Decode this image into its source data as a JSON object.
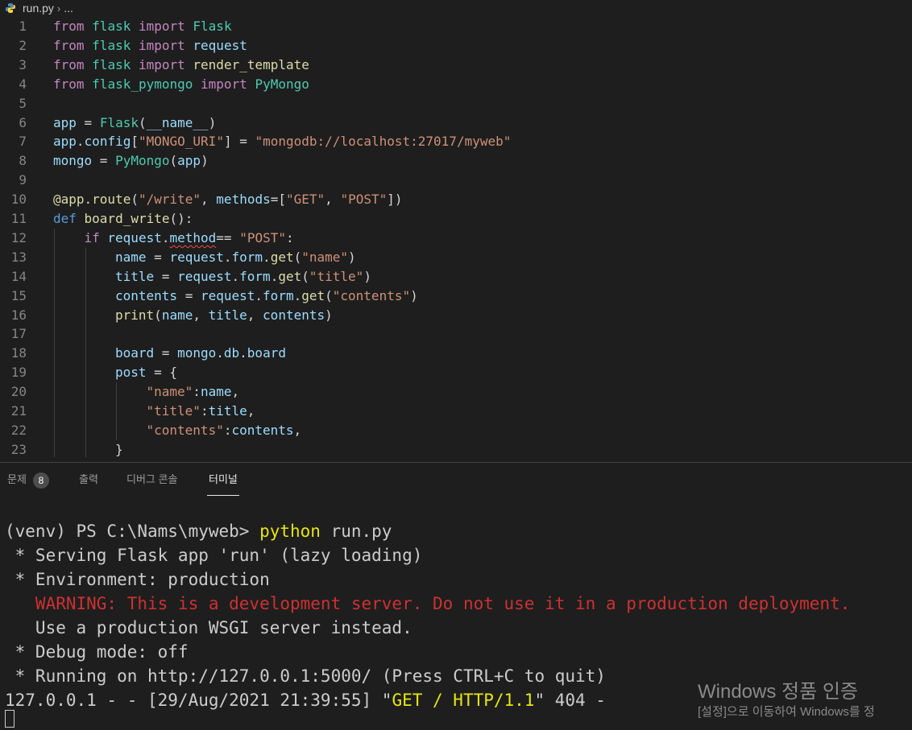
{
  "breadcrumb": {
    "file": "run.py",
    "more": "..."
  },
  "editor": {
    "lines": [
      {
        "n": "1",
        "indent": 0,
        "tokens": [
          [
            "from ",
            "kw"
          ],
          [
            "flask ",
            "mod"
          ],
          [
            "import ",
            "kw"
          ],
          [
            "Flask",
            "cls"
          ]
        ]
      },
      {
        "n": "2",
        "indent": 0,
        "tokens": [
          [
            "from ",
            "kw"
          ],
          [
            "flask ",
            "mod"
          ],
          [
            "import ",
            "kw"
          ],
          [
            "request",
            "var"
          ]
        ]
      },
      {
        "n": "3",
        "indent": 0,
        "tokens": [
          [
            "from ",
            "kw"
          ],
          [
            "flask ",
            "mod"
          ],
          [
            "import ",
            "kw"
          ],
          [
            "render_template",
            "fn"
          ]
        ]
      },
      {
        "n": "4",
        "indent": 0,
        "tokens": [
          [
            "from ",
            "kw"
          ],
          [
            "flask_pymongo ",
            "mod"
          ],
          [
            "import ",
            "kw"
          ],
          [
            "PyMongo",
            "cls"
          ]
        ]
      },
      {
        "n": "5",
        "indent": 0,
        "tokens": []
      },
      {
        "n": "6",
        "indent": 0,
        "tokens": [
          [
            "app",
            "var"
          ],
          [
            " = ",
            "op"
          ],
          [
            "Flask",
            "cls"
          ],
          [
            "(",
            "op"
          ],
          [
            "__name__",
            "var"
          ],
          [
            ")",
            "op"
          ]
        ]
      },
      {
        "n": "7",
        "indent": 0,
        "tokens": [
          [
            "app",
            "var"
          ],
          [
            ".",
            "op"
          ],
          [
            "config",
            "var"
          ],
          [
            "[",
            "op"
          ],
          [
            "\"MONGO_URI\"",
            "str"
          ],
          [
            "] = ",
            "op"
          ],
          [
            "\"mongodb://localhost:27017/myweb\"",
            "str"
          ]
        ]
      },
      {
        "n": "8",
        "indent": 0,
        "tokens": [
          [
            "mongo",
            "var"
          ],
          [
            " = ",
            "op"
          ],
          [
            "PyMongo",
            "cls"
          ],
          [
            "(",
            "op"
          ],
          [
            "app",
            "var"
          ],
          [
            ")",
            "op"
          ]
        ]
      },
      {
        "n": "9",
        "indent": 0,
        "tokens": []
      },
      {
        "n": "10",
        "indent": 0,
        "tokens": [
          [
            "@app.route",
            "fn"
          ],
          [
            "(",
            "op"
          ],
          [
            "\"/write\"",
            "str"
          ],
          [
            ", ",
            "op"
          ],
          [
            "methods",
            "var"
          ],
          [
            "=[",
            "op"
          ],
          [
            "\"GET\"",
            "str"
          ],
          [
            ", ",
            "op"
          ],
          [
            "\"POST\"",
            "str"
          ],
          [
            "])",
            "op"
          ]
        ]
      },
      {
        "n": "11",
        "indent": 0,
        "tokens": [
          [
            "def ",
            "def"
          ],
          [
            "board_write",
            "fn"
          ],
          [
            "():",
            "op"
          ]
        ]
      },
      {
        "n": "12",
        "indent": 1,
        "tokens": [
          [
            "if ",
            "kw"
          ],
          [
            "request",
            "var"
          ],
          [
            ".",
            "op"
          ],
          [
            "method",
            "var"
          ],
          [
            "== ",
            "op"
          ],
          [
            "\"POST\"",
            "str"
          ],
          [
            ":",
            "op"
          ]
        ]
      },
      {
        "n": "13",
        "indent": 2,
        "tokens": [
          [
            "name",
            "var"
          ],
          [
            " = ",
            "op"
          ],
          [
            "request",
            "var"
          ],
          [
            ".",
            "op"
          ],
          [
            "form",
            "var"
          ],
          [
            ".",
            "op"
          ],
          [
            "get",
            "fn"
          ],
          [
            "(",
            "op"
          ],
          [
            "\"name\"",
            "str"
          ],
          [
            ")",
            "op"
          ]
        ]
      },
      {
        "n": "14",
        "indent": 2,
        "tokens": [
          [
            "title",
            "var"
          ],
          [
            " = ",
            "op"
          ],
          [
            "request",
            "var"
          ],
          [
            ".",
            "op"
          ],
          [
            "form",
            "var"
          ],
          [
            ".",
            "op"
          ],
          [
            "get",
            "fn"
          ],
          [
            "(",
            "op"
          ],
          [
            "\"title\"",
            "str"
          ],
          [
            ")",
            "op"
          ]
        ]
      },
      {
        "n": "15",
        "indent": 2,
        "tokens": [
          [
            "contents",
            "var"
          ],
          [
            " = ",
            "op"
          ],
          [
            "request",
            "var"
          ],
          [
            ".",
            "op"
          ],
          [
            "form",
            "var"
          ],
          [
            ".",
            "op"
          ],
          [
            "get",
            "fn"
          ],
          [
            "(",
            "op"
          ],
          [
            "\"contents\"",
            "str"
          ],
          [
            ")",
            "op"
          ]
        ]
      },
      {
        "n": "16",
        "indent": 2,
        "tokens": [
          [
            "print",
            "fn"
          ],
          [
            "(",
            "op"
          ],
          [
            "name",
            "var"
          ],
          [
            ", ",
            "op"
          ],
          [
            "title",
            "var"
          ],
          [
            ", ",
            "op"
          ],
          [
            "contents",
            "var"
          ],
          [
            ")",
            "op"
          ]
        ]
      },
      {
        "n": "17",
        "indent": 2,
        "tokens": []
      },
      {
        "n": "18",
        "indent": 2,
        "tokens": [
          [
            "board",
            "var"
          ],
          [
            " = ",
            "op"
          ],
          [
            "mongo",
            "var"
          ],
          [
            ".",
            "op"
          ],
          [
            "db",
            "var"
          ],
          [
            ".",
            "op"
          ],
          [
            "board",
            "var"
          ]
        ]
      },
      {
        "n": "19",
        "indent": 2,
        "tokens": [
          [
            "post",
            "var"
          ],
          [
            " = {",
            "op"
          ]
        ]
      },
      {
        "n": "20",
        "indent": 3,
        "tokens": [
          [
            "\"name\"",
            "str"
          ],
          [
            ":",
            "op"
          ],
          [
            "name",
            "var"
          ],
          [
            ",",
            "op"
          ]
        ]
      },
      {
        "n": "21",
        "indent": 3,
        "tokens": [
          [
            "\"title\"",
            "str"
          ],
          [
            ":",
            "op"
          ],
          [
            "title",
            "var"
          ],
          [
            ",",
            "op"
          ]
        ]
      },
      {
        "n": "22",
        "indent": 3,
        "tokens": [
          [
            "\"contents\"",
            "str"
          ],
          [
            ":",
            "op"
          ],
          [
            "contents",
            "var"
          ],
          [
            ",",
            "op"
          ]
        ]
      },
      {
        "n": "23",
        "indent": 2,
        "tokens": [
          [
            "}",
            "op"
          ]
        ]
      }
    ]
  },
  "colors": {
    "kw": "#c586c0",
    "mod": "#4ec9b0",
    "cls": "#4ec9b0",
    "var": "#9cdcfe",
    "fn": "#dcdcaa",
    "str": "#ce9178",
    "op": "#d4d4d4",
    "def": "#569cd6",
    "term_default": "#cccccc",
    "term_yellow": "#e5e510",
    "term_red": "#cd3131"
  },
  "panel": {
    "tabs": [
      {
        "label": "문제",
        "badge": "8"
      },
      {
        "label": "출력"
      },
      {
        "label": "디버그 콘솔"
      },
      {
        "label": "터미널",
        "active": true
      }
    ]
  },
  "terminal": {
    "lines": [
      [
        [
          "(venv) PS C:\\Nams\\myweb> ",
          "term_default"
        ],
        [
          "python",
          "term_yellow"
        ],
        [
          " run.py",
          "term_default"
        ]
      ],
      [
        [
          " * Serving Flask app 'run' (lazy loading)",
          "term_default"
        ]
      ],
      [
        [
          " * Environment: production",
          "term_default"
        ]
      ],
      [
        [
          "   WARNING: This is a development server. Do not use it in a production deployment.",
          "term_red"
        ]
      ],
      [
        [
          "   Use a production WSGI server instead.",
          "term_default"
        ]
      ],
      [
        [
          " * Debug mode: off",
          "term_default"
        ]
      ],
      [
        [
          " * Running on http://127.0.0.1:5000/ (Press CTRL+C to quit)",
          "term_default"
        ]
      ],
      [
        [
          "127.0.0.1 - - [29/Aug/2021 21:39:55] \"",
          "term_default"
        ],
        [
          "GET / HTTP/1.1",
          "term_yellow"
        ],
        [
          "\" 404 -",
          "term_default"
        ]
      ]
    ]
  },
  "watermark": {
    "title": "Windows 정품 인증",
    "subtitle": "[설정]으로 이동하여 Windows를 정"
  }
}
